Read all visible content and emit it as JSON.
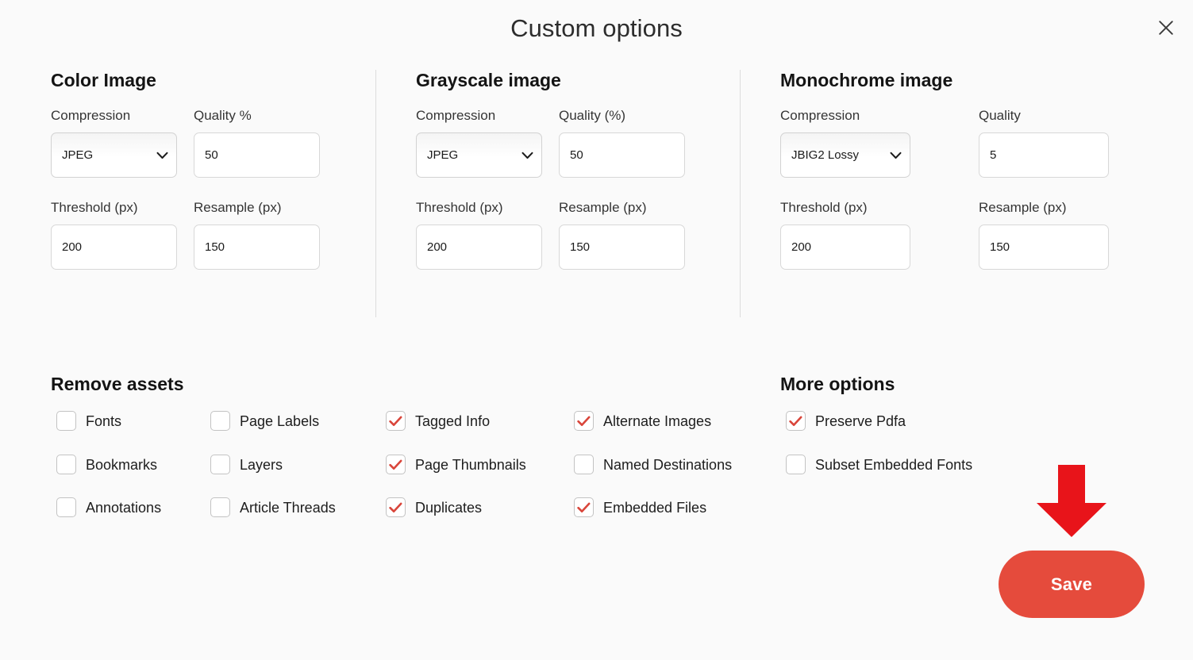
{
  "dialog": {
    "title": "Custom options",
    "close_icon": "close-icon"
  },
  "sections": {
    "color": {
      "heading": "Color Image",
      "compression_label": "Compression",
      "compression_value": "JPEG",
      "compression_options": [
        "JPEG"
      ],
      "quality_label": "Quality %",
      "quality_value": "50",
      "threshold_label": "Threshold (px)",
      "threshold_value": "200",
      "resample_label": "Resample (px)",
      "resample_value": "150"
    },
    "grayscale": {
      "heading": "Grayscale image",
      "compression_label": "Compression",
      "compression_value": "JPEG",
      "compression_options": [
        "JPEG"
      ],
      "quality_label": "Quality (%)",
      "quality_value": "50",
      "threshold_label": "Threshold (px)",
      "threshold_value": "200",
      "resample_label": "Resample (px)",
      "resample_value": "150"
    },
    "monochrome": {
      "heading": "Monochrome image",
      "compression_label": "Compression",
      "compression_value": "JBIG2 Lossy",
      "compression_options": [
        "JBIG2 Lossy"
      ],
      "quality_label": "Quality",
      "quality_value": "5",
      "threshold_label": "Threshold (px)",
      "threshold_value": "200",
      "resample_label": "Resample (px)",
      "resample_value": "150"
    }
  },
  "remove_assets": {
    "heading": "Remove assets",
    "items": [
      {
        "label": "Fonts",
        "checked": false,
        "col": 1,
        "row": 1
      },
      {
        "label": "Bookmarks",
        "checked": false,
        "col": 1,
        "row": 2
      },
      {
        "label": "Annotations",
        "checked": false,
        "col": 1,
        "row": 3
      },
      {
        "label": "Page Labels",
        "checked": false,
        "col": 2,
        "row": 1
      },
      {
        "label": "Layers",
        "checked": false,
        "col": 2,
        "row": 2
      },
      {
        "label": "Article Threads",
        "checked": false,
        "col": 2,
        "row": 3
      },
      {
        "label": "Tagged Info",
        "checked": true,
        "col": 3,
        "row": 1
      },
      {
        "label": "Page Thumbnails",
        "checked": true,
        "col": 3,
        "row": 2
      },
      {
        "label": "Duplicates",
        "checked": true,
        "col": 3,
        "row": 3
      },
      {
        "label": "Alternate Images",
        "checked": true,
        "col": 4,
        "row": 1
      },
      {
        "label": "Named Destinations",
        "checked": false,
        "col": 4,
        "row": 2
      },
      {
        "label": "Embedded Files",
        "checked": true,
        "col": 4,
        "row": 3
      }
    ]
  },
  "more_options": {
    "heading": "More options",
    "items": [
      {
        "label": "Preserve Pdfa",
        "checked": true,
        "col": 5,
        "row": 1
      },
      {
        "label": "Subset Embedded Fonts",
        "checked": false,
        "col": 5,
        "row": 2
      }
    ]
  },
  "footer": {
    "save_label": "Save",
    "arrow_icon": "arrow-down-icon"
  },
  "colors": {
    "page_background": "#fafafa",
    "save_button": "#e54b3c",
    "arrow_red": "#e8141a",
    "checkmark_red": "#d9453a",
    "heading_text": "#141414",
    "label_text": "#353535",
    "divider": "#dcdcdc"
  }
}
